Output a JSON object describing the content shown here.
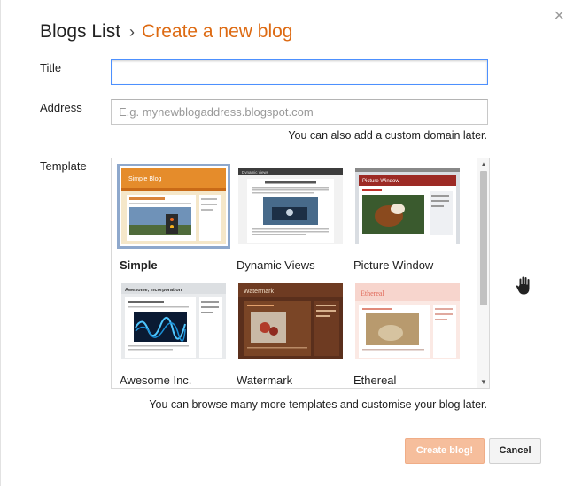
{
  "header": {
    "breadcrumb_parent": "Blogs List",
    "separator": "›",
    "current": "Create a new blog",
    "close_glyph": "×"
  },
  "form": {
    "title_label": "Title",
    "title_value": "",
    "address_label": "Address",
    "address_placeholder": "E.g. mynewblogaddress.blogspot.com",
    "address_hint": "You can also add a custom domain later.",
    "template_label": "Template"
  },
  "templates": [
    {
      "name": "Simple",
      "selected": true
    },
    {
      "name": "Dynamic Views",
      "selected": false
    },
    {
      "name": "Picture Window",
      "selected": false
    },
    {
      "name": "Awesome Inc.",
      "selected": false
    },
    {
      "name": "Watermark",
      "selected": false
    },
    {
      "name": "Ethereal",
      "selected": false
    }
  ],
  "thumb_text": {
    "simple": "Simple Blog",
    "dynamic": "Dynamic views",
    "picture": "Picture Window",
    "awesome": "Awesome, Incorporation",
    "watermark": "Watermark",
    "ethereal": "Ethereal"
  },
  "browse_hint": "You can browse many more templates and customise your blog later.",
  "buttons": {
    "create": "Create blog!",
    "cancel": "Cancel"
  },
  "colors": {
    "accent": "#dd6a12",
    "create_button": "#f6be9c",
    "selected_outline": "#8ea8cc",
    "focus_border": "#4d90fe"
  },
  "icons": {
    "close": "close-icon",
    "cursor": "hand-cursor-icon",
    "scroll_up": "scroll-up-arrow-icon",
    "scroll_down": "scroll-down-arrow-icon"
  }
}
